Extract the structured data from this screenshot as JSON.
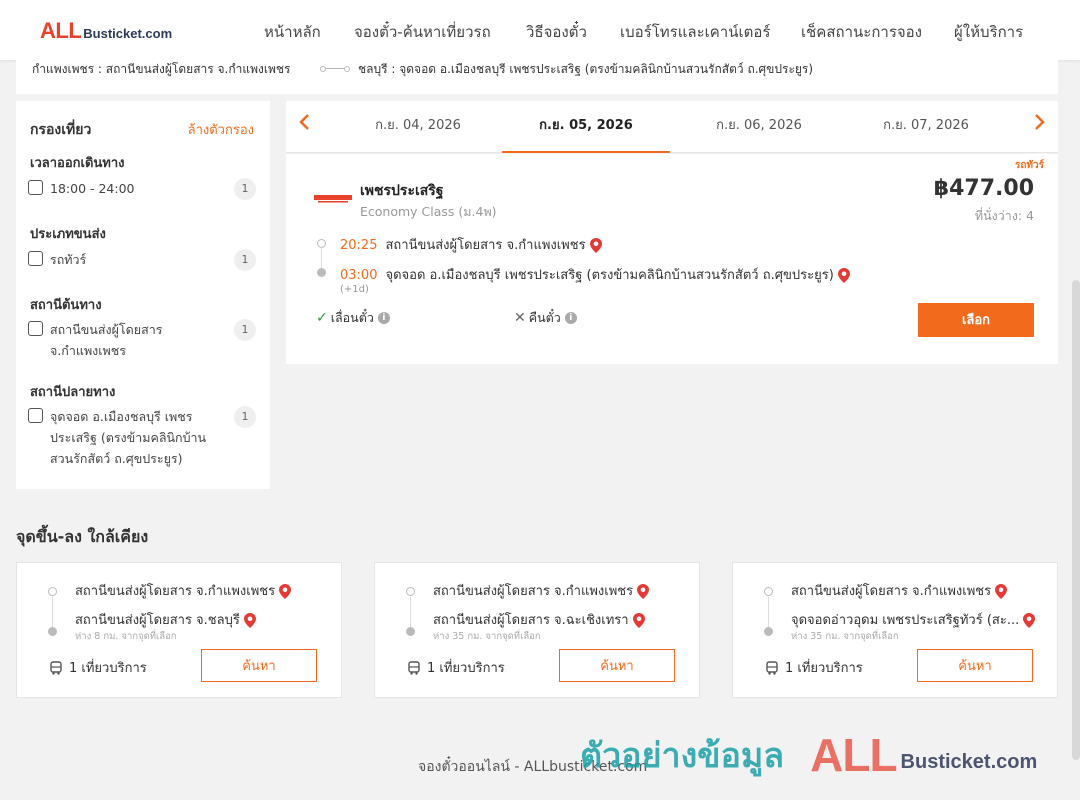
{
  "header": {
    "logo_all": "ALL",
    "logo_domain": "Busticket.com",
    "nav": [
      {
        "label": "หน้าหลัก"
      },
      {
        "label": "จองตั๋ว-ค้นหาเที่ยวรถ"
      },
      {
        "label": "วิธีจองตั๋ว"
      },
      {
        "label": "เบอร์โทรและเคาน์เตอร์"
      },
      {
        "label": "เช็คสถานะการจอง"
      },
      {
        "label": "ผู้ให้บริการ"
      }
    ]
  },
  "route": {
    "from": "กำแพงเพชร : สถานีขนส่งผู้โดยสาร จ.กำแพงเพชร",
    "to": "ชลบุรี : จุดจอด อ.เมืองชลบุรี เพชรประเสริฐ (ตรงข้ามคลินิกบ้านสวนรักสัตว์ ถ.ศุขประยูร)"
  },
  "filter": {
    "title": "กรองเที่ยว",
    "clear_label": "ล้างตัวกรอง",
    "groups": [
      {
        "title": "เวลาออกเดินทาง",
        "option": "18:00 - 24:00",
        "count": "1"
      },
      {
        "title": "ประเภทขนส่ง",
        "option": "รถทัวร์",
        "count": "1"
      },
      {
        "title": "สถานีต้นทาง",
        "option": "สถานีขนส่งผู้โดยสาร จ.กำแพงเพชร",
        "count": "1"
      },
      {
        "title": "สถานีปลายทาง",
        "option": "จุดจอด อ.เมืองชลบุรี เพชรประเสริฐ (ตรงข้ามคลินิกบ้านสวนรักสัตว์ ถ.ศุขประยูร)",
        "count": "1"
      }
    ]
  },
  "dates": {
    "tabs": [
      {
        "label": "ก.ย. 04, 2026"
      },
      {
        "label": "ก.ย. 05, 2026"
      },
      {
        "label": "ก.ย. 06, 2026"
      },
      {
        "label": "ก.ย. 07, 2026"
      }
    ],
    "prev_icon": "chevron-left-icon",
    "next_icon": "chevron-right-icon"
  },
  "trip": {
    "bus_type": "รถทัวร์",
    "operator": "เพชรประเสริฐ",
    "class": "Economy Class (ม.4พ)",
    "price": "฿477.00",
    "seats": "ที่นั่งว่าง: 4",
    "depart_time": "20:25",
    "depart_station": "สถานีขนส่งผู้โดยสาร จ.กำแพงเพชร",
    "arrive_time": "03:00",
    "arrive_station": "จุดจอด อ.เมืองชลบุรี เพชรประเสริฐ (ตรงข้ามคลินิกบ้านสวนรักสัตว์ ถ.ศุขประยูร)",
    "plus_day": "(+1d)",
    "reschedule_label": "เลื่อนตั๋ว",
    "refund_label": "คืนตั๋ว",
    "select_label": "เลือก"
  },
  "nearby": {
    "title": "จุดขึ้น-ลง ใกล้เคียง",
    "cards": [
      {
        "from": "สถานีขนส่งผู้โดยสาร จ.กำแพงเพชร",
        "to": "สถานีขนส่งผู้โดยสาร จ.ชลบุรี",
        "distance": "ห่าง 8 กม. จากจุดที่เลือก",
        "trips": "1 เที่ยวบริการ",
        "button": "ค้นหา"
      },
      {
        "from": "สถานีขนส่งผู้โดยสาร จ.กำแพงเพชร",
        "to": "สถานีขนส่งผู้โดยสาร จ.ฉะเชิงเทรา",
        "distance": "ห่าง 35 กม. จากจุดที่เลือก",
        "trips": "1 เที่ยวบริการ",
        "button": "ค้นหา"
      },
      {
        "from": "สถานีขนส่งผู้โดยสาร จ.กำแพงเพชร",
        "to": "จุดจอดอ่าวอุดม เพชรประเสริฐทัวร์ (สะ...",
        "distance": "ห่าง 35 กม. จากจุดที่เลือก",
        "trips": "1 เที่ยวบริการ",
        "button": "ค้นหา"
      }
    ]
  },
  "footer": {
    "text": "จองตั๋วออนไลน์ - ALLbusticket.com"
  },
  "watermark": {
    "thai": "ตัวอย่างข้อมูล",
    "all": "ALL",
    "domain": "Busticket.com"
  },
  "colors": {
    "accent": "#f26b1d",
    "logo_red": "#e8412c",
    "watermark_teal": "#1aa0a8"
  }
}
